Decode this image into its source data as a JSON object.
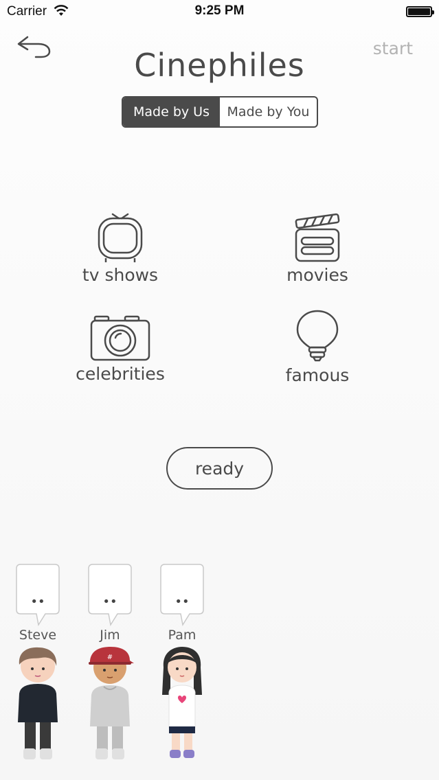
{
  "status_bar": {
    "carrier": "Carrier",
    "time": "9:25 PM"
  },
  "header": {
    "title": "Cinephiles",
    "start_label": "start"
  },
  "segments": [
    {
      "label": "Made by Us",
      "selected": true
    },
    {
      "label": "Made by You",
      "selected": false
    }
  ],
  "categories": [
    {
      "label": "tv shows",
      "icon": "tv-icon"
    },
    {
      "label": "movies",
      "icon": "clapperboard-icon"
    },
    {
      "label": "celebrities",
      "icon": "camera-icon"
    },
    {
      "label": "famous",
      "icon": "lightbulb-icon"
    }
  ],
  "ready_label": "ready",
  "players": [
    {
      "name": "Steve",
      "bubble": "••"
    },
    {
      "name": "Jim",
      "bubble": "••"
    },
    {
      "name": "Pam",
      "bubble": "••"
    }
  ],
  "colors": {
    "ink": "#4a4a4a",
    "accent_grey": "#b3b3b3",
    "background": "#f9f9f9"
  }
}
